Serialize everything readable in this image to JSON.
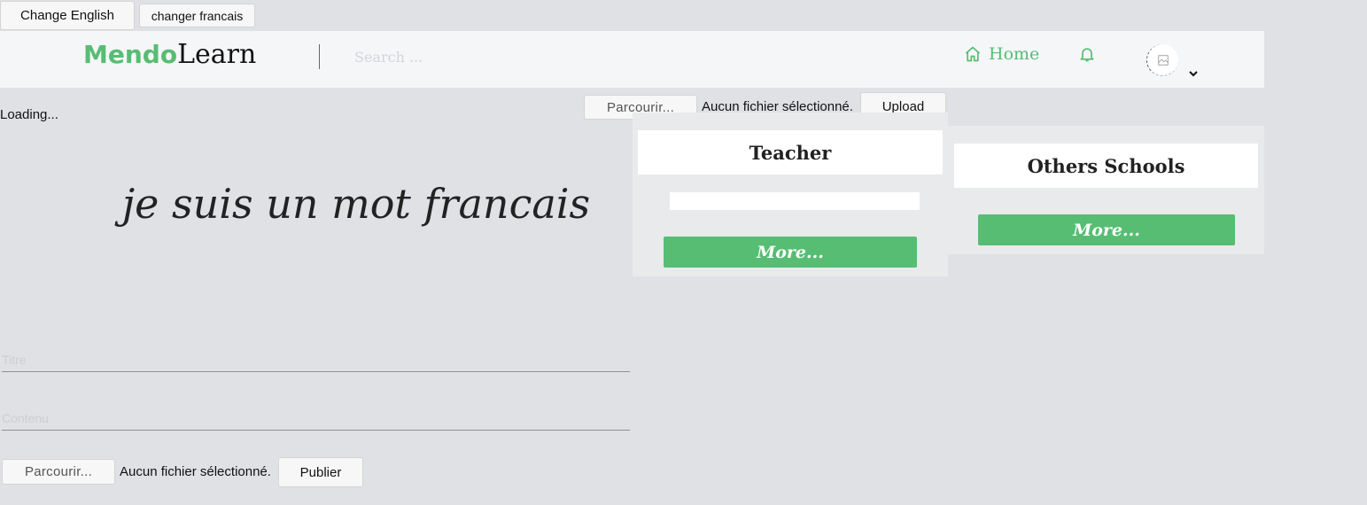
{
  "language_buttons": {
    "english": "Change English",
    "french": "changer francais"
  },
  "header": {
    "logo_part1": "Mendo",
    "logo_part2": "Learn",
    "search_placeholder": "Search ...",
    "nav_home": "Home",
    "home_icon": "home-icon",
    "bell_icon": "bell-icon",
    "avatar_icon": "broken-image-icon",
    "caret_icon": "chevron-down-icon"
  },
  "upload": {
    "browse_label": "Parcourir...",
    "no_file_text": "Aucun fichier sélectionné.",
    "upload_label": "Upload"
  },
  "loading_text": "Loading...",
  "hero_text": "je suis un mot francais",
  "cards": {
    "teacher": {
      "title": "Teacher",
      "more_label": "More..."
    },
    "others_schools": {
      "title": "Others Schools",
      "more_label": "More..."
    }
  },
  "post_form": {
    "title_placeholder": "Titre",
    "content_placeholder": "Contenu",
    "browse_label": "Parcourir...",
    "no_file_text": "Aucun fichier sélectionné.",
    "publish_label": "Publier"
  },
  "colors": {
    "accent": "#57bd73",
    "background": "#dfe1e5",
    "header_bg": "#f5f6f8"
  }
}
